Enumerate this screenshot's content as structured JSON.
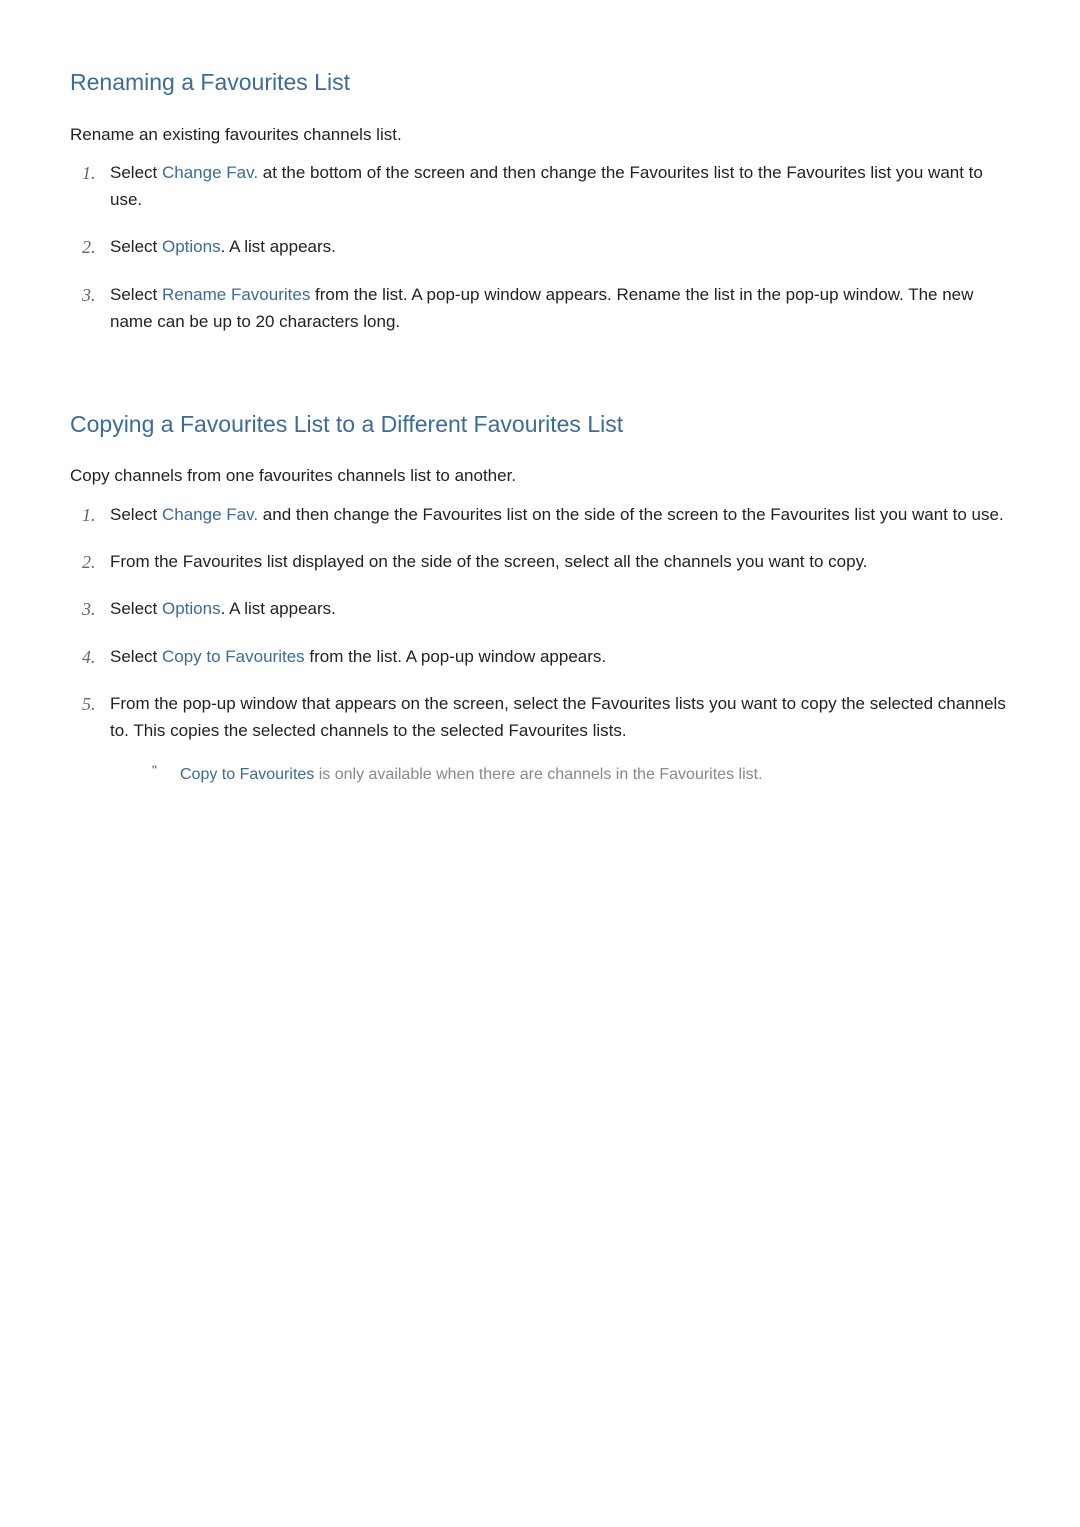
{
  "section1": {
    "heading": "Renaming a Favourites List",
    "intro": "Rename an existing favourites channels list.",
    "steps": [
      {
        "number": "1.",
        "prefix": "Select ",
        "highlight": "Change Fav.",
        "suffix": " at the bottom of the screen and then change the Favourites list to the Favourites list you want to use."
      },
      {
        "number": "2.",
        "prefix": "Select ",
        "highlight": "Options",
        "suffix": ". A list appears."
      },
      {
        "number": "3.",
        "prefix": "Select ",
        "highlight": "Rename Favourites",
        "suffix": " from the list. A pop-up window appears. Rename the list in the pop-up window. The new name can be up to 20 characters long."
      }
    ]
  },
  "section2": {
    "heading": "Copying a Favourites List to a Different Favourites List",
    "intro": "Copy channels from one favourites channels list to another.",
    "steps": [
      {
        "number": "1.",
        "prefix": "Select ",
        "highlight": "Change Fav.",
        "suffix": " and then change the Favourites list on the side of the screen to the Favourites list you want to use."
      },
      {
        "number": "2.",
        "prefix": "",
        "highlight": "",
        "suffix": "From the Favourites list displayed on the side of the screen, select all the channels you want to copy."
      },
      {
        "number": "3.",
        "prefix": "Select ",
        "highlight": "Options",
        "suffix": ". A list appears."
      },
      {
        "number": "4.",
        "prefix": "Select ",
        "highlight": "Copy to Favourites",
        "suffix": " from the list. A pop-up window appears."
      },
      {
        "number": "5.",
        "prefix": "",
        "highlight": "",
        "suffix": "From the pop-up window that appears on the screen, select the Favourites lists you want to copy the selected channels to. This copies the selected channels to the selected Favourites lists."
      }
    ],
    "note": {
      "marker": "\"",
      "highlight": "Copy to Favourites",
      "suffix": " is only available when there are channels in the Favourites list."
    }
  }
}
